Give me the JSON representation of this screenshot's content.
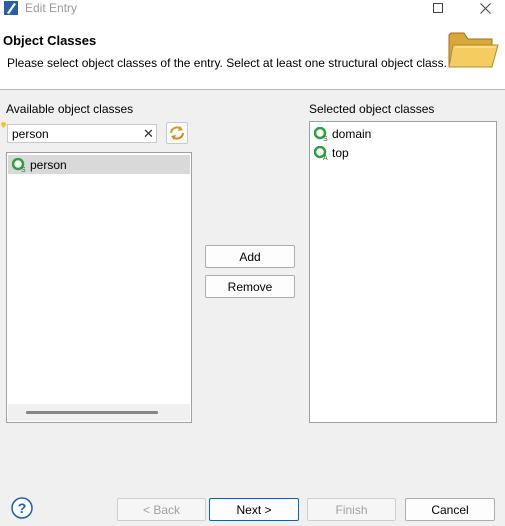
{
  "window": {
    "title": "Edit Entry",
    "maximize_glyph": "☐",
    "close_glyph": "✕"
  },
  "header": {
    "title": "Object Classes",
    "description": "Please select object classes of the entry. Select at least one structural object class.",
    "icon": "folder-icon"
  },
  "available": {
    "label": "Available object classes",
    "filter_value": "person",
    "clear_glyph": "✕",
    "items": [
      {
        "label": "person",
        "kind": "S",
        "selected": true
      }
    ]
  },
  "selected": {
    "label": "Selected object classes",
    "items": [
      {
        "label": "domain",
        "kind": "S"
      },
      {
        "label": "top",
        "kind": "A"
      }
    ]
  },
  "actions": {
    "add": "Add",
    "remove": "Remove"
  },
  "footer": {
    "back": "< Back",
    "next": "Next >",
    "finish": "Finish",
    "cancel": "Cancel",
    "back_enabled": false,
    "finish_enabled": false
  },
  "colors": {
    "accent": "#0067c0",
    "object_class_green": "#2e9e3e",
    "help_blue": "#1e5fa8"
  }
}
